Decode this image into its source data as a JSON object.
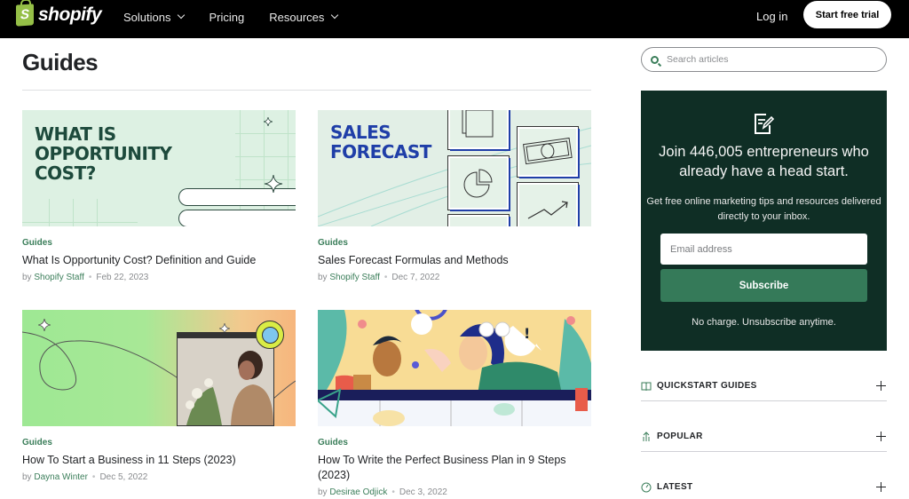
{
  "header": {
    "brand": "shopify",
    "brand_letter": "S",
    "nav": [
      {
        "label": "Solutions",
        "has_dropdown": true
      },
      {
        "label": "Pricing",
        "has_dropdown": false
      },
      {
        "label": "Resources",
        "has_dropdown": true
      }
    ],
    "login_label": "Log in",
    "cta_label": "Start free trial"
  },
  "main": {
    "title": "Guides",
    "articles": [
      {
        "category": "Guides",
        "title": "What Is Opportunity Cost? Definition and Guide",
        "by": "by",
        "author": "Shopify Staff",
        "date": "Feb 22, 2023",
        "thumb_headline": [
          "WHAT IS",
          "OPPORTUNITY",
          "COST?"
        ]
      },
      {
        "category": "Guides",
        "title": "Sales Forecast Formulas and Methods",
        "by": "by",
        "author": "Shopify Staff",
        "date": "Dec 7, 2022",
        "thumb_headline": [
          "SALES",
          "FORECAST"
        ]
      },
      {
        "category": "Guides",
        "title": "How To Start a Business in 11 Steps (2023)",
        "by": "by",
        "author": "Dayna Winter",
        "date": "Dec 5, 2022"
      },
      {
        "category": "Guides",
        "title": "How To Write the Perfect Business Plan in 9 Steps (2023)",
        "by": "by",
        "author": "Desirae Odjick",
        "date": "Dec 3, 2022"
      }
    ]
  },
  "sidebar": {
    "search": {
      "placeholder": "Search articles",
      "value": ""
    },
    "promo": {
      "icon": "edit-document-icon",
      "headline": "Join 446,005 entrepreneurs who already have a head start.",
      "body": "Get free online marketing tips and resources delivered directly to your inbox.",
      "email_placeholder": "Email address",
      "subscribe_label": "Subscribe",
      "note": "No charge. Unsubscribe anytime."
    },
    "sections": [
      {
        "label": "QUICKSTART GUIDES",
        "icon": "book-icon"
      },
      {
        "label": "POPULAR",
        "icon": "trending-icon"
      },
      {
        "label": "LATEST",
        "icon": "clock-icon"
      }
    ]
  },
  "colors": {
    "brand_green": "#95bf47",
    "accent_green": "#3b7e5a",
    "promo_bg": "#0f2e25",
    "subscribe_bg": "#357a59"
  }
}
